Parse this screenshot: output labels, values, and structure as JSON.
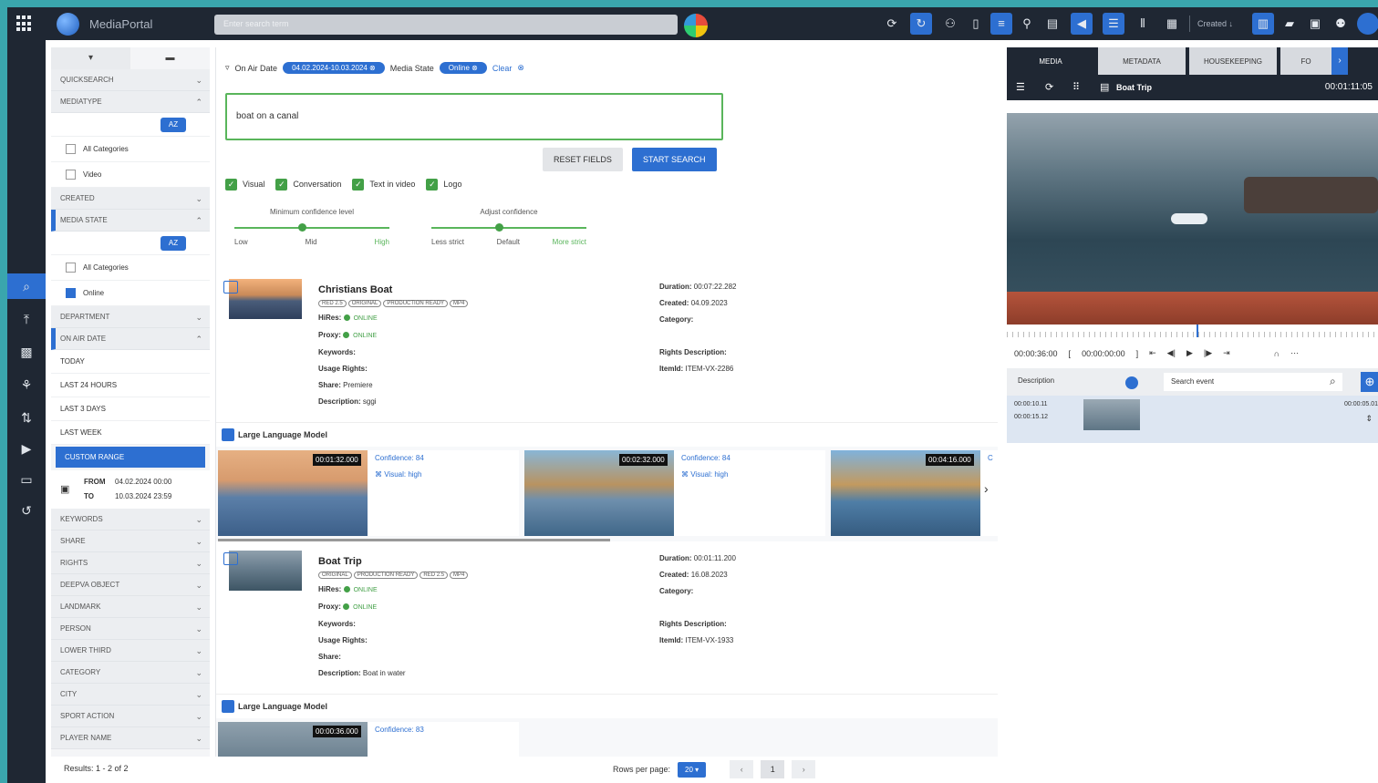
{
  "app": {
    "brand": "MediaPortal",
    "search_placeholder": "Enter search term"
  },
  "topbar": {
    "created_label": "Created"
  },
  "filters": {
    "sections": {
      "quicksearch": "QUICKSEARCH",
      "mediatype": "MEDIATYPE",
      "created": "CREATED",
      "media_state": "MEDIA STATE",
      "department": "DEPARTMENT",
      "on_air_date": "ON AIR DATE",
      "keywords": "KEYWORDS",
      "share": "SHARE",
      "rights": "RIGHTS",
      "deepva_object": "DEEPVA OBJECT",
      "landmark": "LANDMARK",
      "person": "PERSON",
      "lower_third": "LOWER THIRD",
      "category": "CATEGORY",
      "city": "CITY",
      "sport_action": "SPORT ACTION",
      "player_name": "PLAYER NAME"
    },
    "mediatype_options": [
      "All Categories",
      "Video"
    ],
    "media_state_options": [
      "All Categories",
      "Online"
    ],
    "date_options": [
      "TODAY",
      "LAST 24 HOURS",
      "LAST 3 DAYS",
      "LAST WEEK",
      "CUSTOM RANGE"
    ],
    "range": {
      "from_label": "FROM",
      "from": "04.02.2024 00:00",
      "to_label": "TO",
      "to": "10.03.2024 23:59"
    },
    "sort_label": "AZ"
  },
  "results_label": "Results: 1 - 2 of 2",
  "main": {
    "chips": {
      "air_label": "On Air Date",
      "air_value": "04.02.2024-10.03.2024",
      "state_label": "Media State",
      "state_value": "Online",
      "clear": "Clear"
    },
    "query": "boat on a canal",
    "reset": "RESET FIELDS",
    "start": "START SEARCH",
    "checks": [
      "Visual",
      "Conversation",
      "Text in video",
      "Logo"
    ],
    "slider1": {
      "title": "Minimum confidence level",
      "ticks": [
        "Low",
        "Mid",
        "High"
      ]
    },
    "slider2": {
      "title": "Adjust confidence",
      "ticks": [
        "Less strict",
        "Default",
        "More strict"
      ]
    }
  },
  "items": [
    {
      "title": "Christians Boat",
      "tags": [
        "RED 2.5",
        "ORIGINAL",
        "PRODUCTION READY",
        "MP4"
      ],
      "hires": "ONLINE",
      "proxy": "ONLINE",
      "usage": "",
      "share": "Premiere",
      "description": "sggi",
      "duration": "00:07:22.282",
      "created": "04.09.2023",
      "category": "",
      "rights": "",
      "itemid": "ITEM-VX-2286",
      "llm": "Large Language Model",
      "clips": [
        {
          "tc": "00:01:32.000",
          "conf": "Confidence: 84",
          "vis": "Visual: high"
        },
        {
          "tc": "00:02:32.000",
          "conf": "Confidence: 84",
          "vis": "Visual: high"
        },
        {
          "tc": "00:04:16.000",
          "conf": "C",
          "vis": ""
        }
      ]
    },
    {
      "title": "Boat Trip",
      "tags": [
        "ORIGINAL",
        "PRODUCTION READY",
        "RED 2.5",
        "MP4"
      ],
      "hires": "ONLINE",
      "proxy": "ONLINE",
      "usage": "",
      "share": "",
      "description": "Boat in water",
      "duration": "00:01:11.200",
      "created": "16.08.2023",
      "category": "",
      "rights": "",
      "itemid": "ITEM-VX-1933",
      "llm": "Large Language Model",
      "clips": [
        {
          "tc": "00:00:36.000",
          "conf": "Confidence: 83",
          "vis": ""
        }
      ]
    }
  ],
  "labels": {
    "hires": "HiRes:",
    "proxy": "Proxy:",
    "keywords": "Keywords:",
    "usage": "Usage Rights:",
    "share": "Share:",
    "description": "Description:",
    "duration": "Duration:",
    "created": "Created:",
    "category": "Category:",
    "rights": "Rights Description:",
    "itemid": "ItemId:"
  },
  "pager": {
    "rows_label": "Rows per page:",
    "rows": "20",
    "page": "1"
  },
  "media": {
    "tabs": [
      "MEDIA",
      "METADATA",
      "HOUSEKEEPING",
      "FO"
    ],
    "file": "Boat Trip",
    "duration": "00:01:11:05",
    "tc_current": "00:00:36:00",
    "tc_in": "00:00:00:00",
    "desc_label": "Description",
    "search_event": "Search event",
    "event": {
      "in": "00:00:10.11",
      "out": "00:00:15.12",
      "dur": "00:00:05.01"
    }
  }
}
